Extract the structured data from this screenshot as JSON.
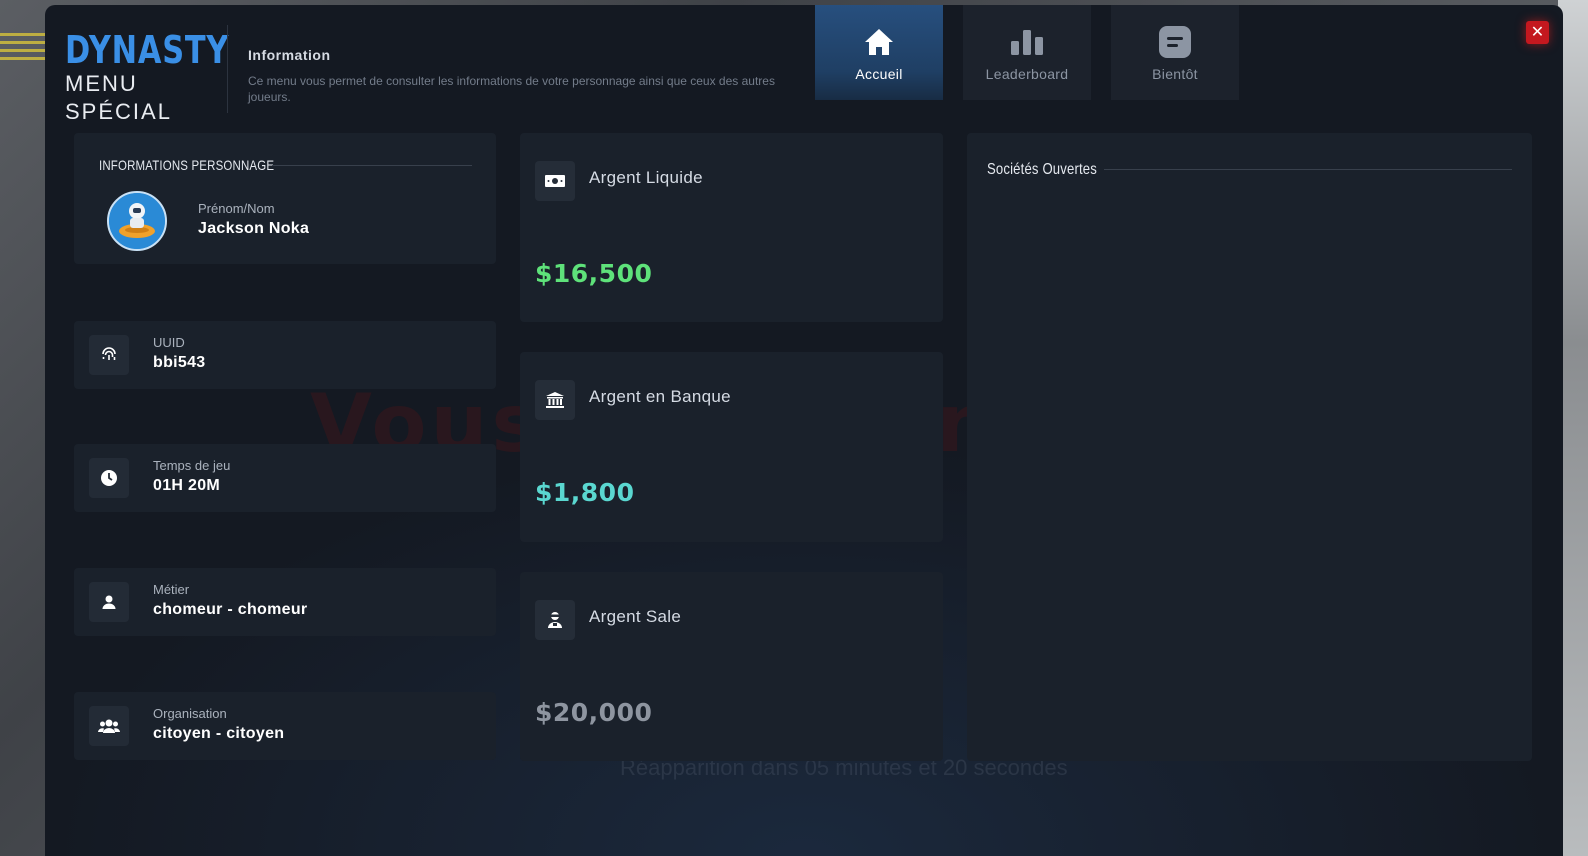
{
  "brand": {
    "title": "DYNASTY",
    "line1": "MENU",
    "line2": "SPÉCIAL"
  },
  "info": {
    "title": "Information",
    "text": "Ce menu vous permet de consulter les informations de votre personnage ainsi que ceux des autres joueurs."
  },
  "tabs": [
    {
      "label": "Accueil",
      "icon": "home-icon",
      "active": true
    },
    {
      "label": "Leaderboard",
      "icon": "bar-chart-icon",
      "active": false
    },
    {
      "label": "Bientôt",
      "icon": "message-icon",
      "active": false
    }
  ],
  "close_label": "✕",
  "personnage": {
    "section_title": "INFORMATIONS PERSONNAGE",
    "name_label": "Prénom/Nom",
    "name_value": "Jackson Noka"
  },
  "stats": {
    "uuid": {
      "label": "UUID",
      "value": "bbi543",
      "icon": "fingerprint-icon"
    },
    "playtime": {
      "label": "Temps de jeu",
      "value": "01H 20M",
      "icon": "clock-icon"
    },
    "job": {
      "label": "Métier",
      "value": "chomeur - chomeur",
      "icon": "user-icon"
    },
    "organisation": {
      "label": "Organisation",
      "value": "citoyen - citoyen",
      "icon": "users-icon"
    }
  },
  "money": {
    "cash": {
      "label": "Argent Liquide",
      "amount": "$16,500",
      "color": "#5ee27a",
      "icon": "cash-icon"
    },
    "bank": {
      "label": "Argent en Banque",
      "amount": "$1,800",
      "color": "#5ad7d0",
      "icon": "bank-icon"
    },
    "dirty": {
      "label": "Argent Sale",
      "amount": "$20,000",
      "color": "#8e95a0",
      "icon": "thief-icon"
    }
  },
  "societes": {
    "section_title": "Sociétés Ouvertes"
  },
  "background": {
    "overlay_text": "Vous êtes dans le coma",
    "respawn_text": "Réapparition dans 05 minutes et 20 secondes"
  },
  "colors": {
    "accent": "#3a8fe6",
    "panel": "#141922",
    "card": "#1a212b",
    "close": "#c4181f"
  }
}
